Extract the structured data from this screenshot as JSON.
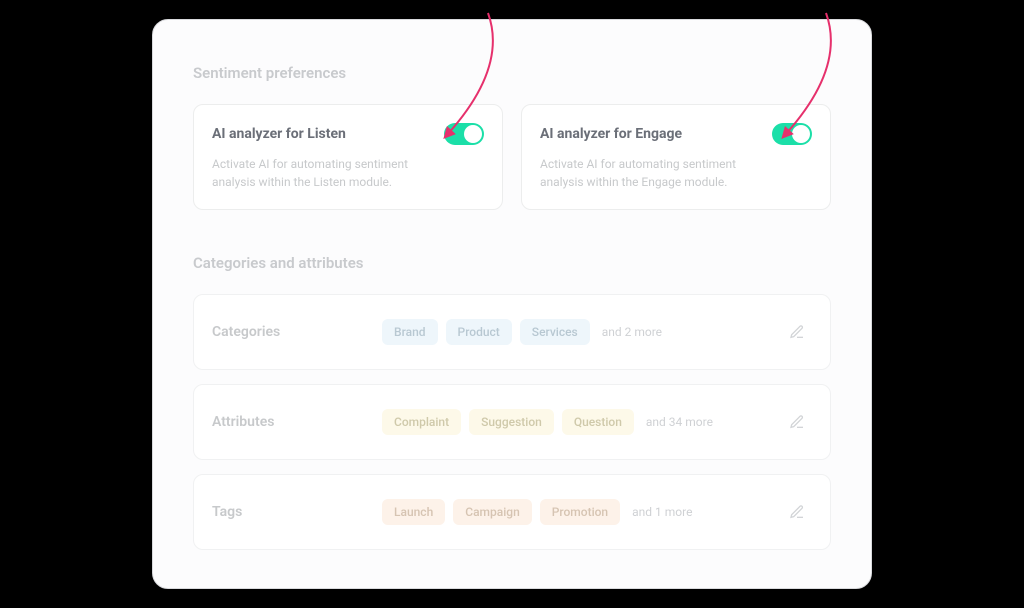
{
  "sentiment": {
    "title": "Sentiment preferences",
    "cards": [
      {
        "title": "AI analyzer for Listen",
        "desc": "Activate AI for automating sentiment analysis within the Listen module.",
        "on": true
      },
      {
        "title": "AI analyzer for Engage",
        "desc": "Activate AI for automating sentiment analysis within the Engage module.",
        "on": true
      }
    ]
  },
  "categories": {
    "title": "Categories and attributes",
    "rows": [
      {
        "label": "Categories",
        "chips": [
          "Brand",
          "Product",
          "Services"
        ],
        "more": "and 2 more",
        "color": "blue"
      },
      {
        "label": "Attributes",
        "chips": [
          "Complaint",
          "Suggestion",
          "Question"
        ],
        "more": "and 34 more",
        "color": "yellow"
      },
      {
        "label": "Tags",
        "chips": [
          "Launch",
          "Campaign",
          "Promotion"
        ],
        "more": "and 1 more",
        "color": "orange"
      }
    ]
  },
  "annotation_color": "#e6306c"
}
